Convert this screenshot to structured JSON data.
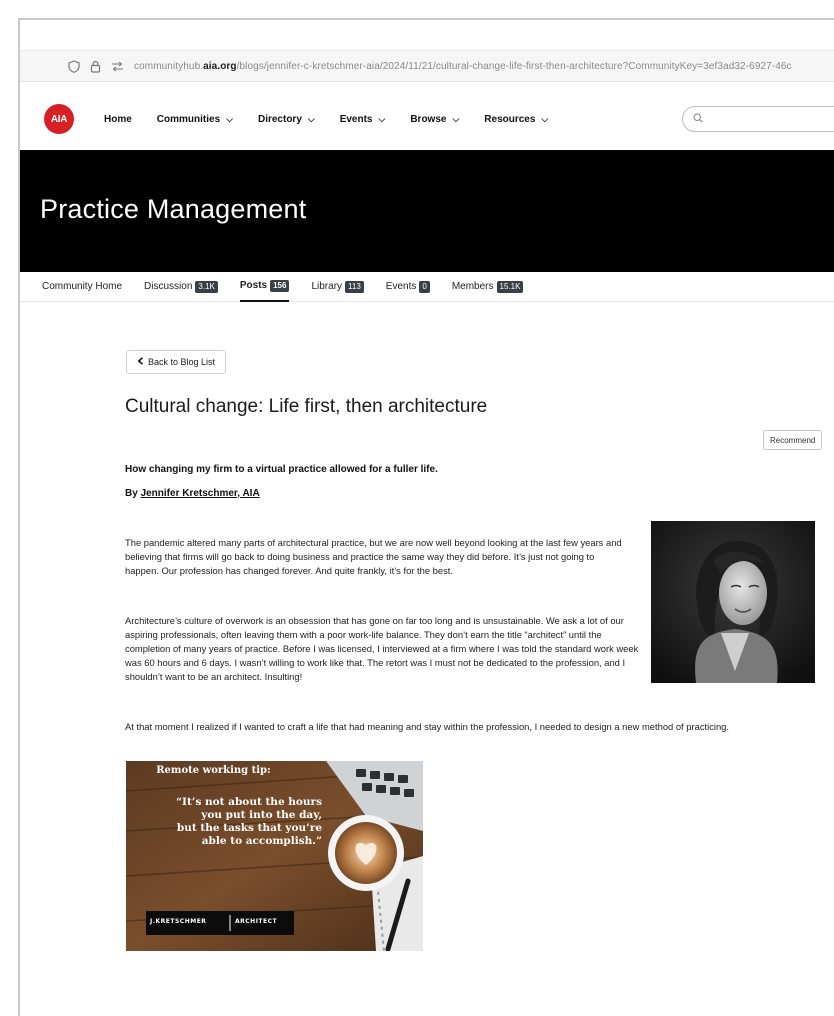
{
  "browser": {
    "url_prefix": "communityhub.",
    "url_domain": "aia.org",
    "url_path": "/blogs/jennifer-c-kretschmer-aia/2024/11/21/cultural-change-life-first-then-architecture?CommunityKey=3ef3ad32-6927-46c"
  },
  "site": {
    "logo_text": "AIA",
    "nav": [
      "Home",
      "Communities",
      "Directory",
      "Events",
      "Browse",
      "Resources"
    ],
    "brand_color": "#d71f26"
  },
  "community": {
    "title": "Practice Management"
  },
  "tabs": [
    {
      "label": "Community Home",
      "badge": ""
    },
    {
      "label": "Discussion",
      "badge": "3.1K"
    },
    {
      "label": "Posts",
      "badge": "156"
    },
    {
      "label": "Library",
      "badge": "113"
    },
    {
      "label": "Events",
      "badge": "0"
    },
    {
      "label": "Members",
      "badge": "15.1K"
    }
  ],
  "post": {
    "back_label": "Back to Blog List",
    "title": "Cultural change: Life first, then architecture",
    "recommend_label": "Recommend",
    "subtitle": "How changing my firm to a virtual practice allowed for a fuller life.",
    "by_prefix": "By ",
    "author": "Jennifer Kretschmer, AIA",
    "paragraphs": [
      "The pandemic altered many parts of architectural practice, but we are now well beyond looking at the last few years and believing that firms will go back to doing business and practice the same way they did before. It’s just not going to happen. Our profession has changed forever. And quite frankly, it’s for the best.",
      "Architecture’s culture of overwork is an obsession that has gone on far too long and is unsustainable. We ask a lot of our aspiring professionals, often leaving them with a poor work-life balance. They don’t earn the title “architect” until the completion of many years of practice. Before I was licensed, I interviewed at a firm where I was told the standard work week was 60 hours and 6 days. I wasn’t willing to work like that. The retort was I must not be dedicated to the profession, and I shouldn’t want to be an architect. Insulting!",
      "At that moment I realized if I wanted to craft a life that had meaning and stay within the profession, I needed to design a new method of practicing."
    ],
    "tip_image": {
      "heading": "Remote working tip:",
      "quote_lines": [
        "“It’s not about the hours",
        "you put into the day,",
        "but the tasks that you’re",
        "able to accomplish.”"
      ],
      "brand_left": "J.KRETSCHMER",
      "brand_right": "ARCHITECT"
    }
  }
}
